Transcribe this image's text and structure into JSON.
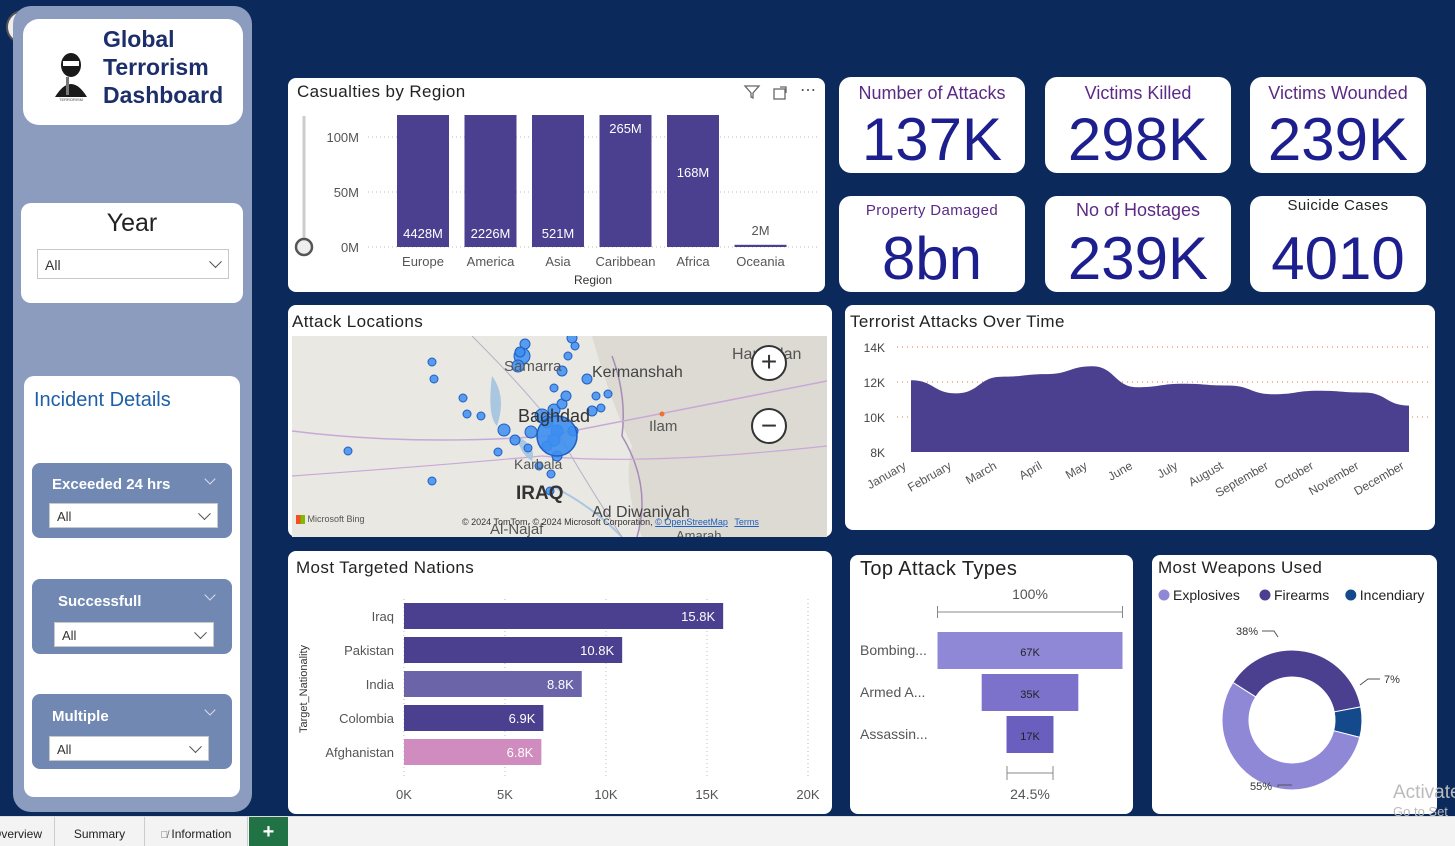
{
  "header": {
    "title_line1": "Global",
    "title_line2": "Terrorism",
    "title_line3": "Dashboard"
  },
  "slicers": {
    "year": {
      "label": "Year",
      "value": "All"
    },
    "incident_title": "Incident Details",
    "exceeded": {
      "label": "Exceeded 24 hrs",
      "value": "All"
    },
    "successful": {
      "label": "Successfull",
      "value": "All"
    },
    "multiple": {
      "label": "Multiple",
      "value": "All"
    }
  },
  "kpis": {
    "attacks": {
      "label": "Number of Attacks",
      "value": "137K"
    },
    "killed": {
      "label": "Victims Killed",
      "value": "298K"
    },
    "wounded": {
      "label": "Victims Wounded",
      "value": "239K"
    },
    "property": {
      "label": "Property Damaged",
      "value": "8bn"
    },
    "hostages": {
      "label": "No of Hostages",
      "value": "239K"
    },
    "suicide": {
      "label": "Suicide Cases",
      "value": "4010"
    }
  },
  "casualties": {
    "title": "Casualties by Region",
    "xlabel": "Region",
    "yticks": [
      "100M",
      "50M",
      "0M"
    ]
  },
  "map": {
    "title": "Attack Locations",
    "labels": {
      "samarra": "Samarra",
      "kermanshah": "Kermanshah",
      "baghdad": "Baghdad",
      "ilam": "Ilam",
      "karbala": "Karbala",
      "iraq": "IRAQ",
      "diwaniyah": "Ad Diwaniyah",
      "najaf": "Al-Najaf",
      "hamadan": "Hamadan",
      "amarah": "Amarah"
    },
    "brand": "Microsoft Bing",
    "attribution": "© 2024 TomTom, © 2024 Microsoft Corporation,",
    "osm": "© OpenStreetMap",
    "terms": "Terms"
  },
  "over_time": {
    "title": "Terrorist Attacks Over Time"
  },
  "nations": {
    "title": "Most Targeted Nations",
    "ylabel": "Target_Nationality"
  },
  "attack_types": {
    "title": "Top Attack Types",
    "top_pct": "100%",
    "bottom_pct": "24.5%"
  },
  "weapons": {
    "title": "Most Weapons Used"
  },
  "tabs": {
    "overview": "Overview",
    "summary": "Summary",
    "information": "Information",
    "add": "+"
  },
  "watermark": {
    "line1": "Activate",
    "line2": "Go to Set"
  },
  "colors": {
    "navy": "#0b2a5b",
    "bar": "#4b3f8f",
    "kpi_value": "#1e1f8f",
    "kpi_label": "#5b2a86",
    "area": "#4b3f8f"
  },
  "chart_data": [
    {
      "type": "bar",
      "title": "Casualties by Region",
      "xlabel": "Region",
      "categories": [
        "Europe",
        "America",
        "Asia",
        "Caribbean",
        "Africa",
        "Oceania"
      ],
      "values": [
        4428,
        2226,
        521,
        265,
        168,
        2
      ],
      "labels": [
        "4428M",
        "2226M",
        "521M",
        "265M",
        "168M",
        "2M"
      ],
      "ylim": [
        0,
        120
      ]
    },
    {
      "type": "area",
      "title": "Terrorist Attacks Over Time",
      "categories": [
        "January",
        "February",
        "March",
        "April",
        "May",
        "June",
        "July",
        "August",
        "September",
        "October",
        "November",
        "December"
      ],
      "values": [
        12100,
        11350,
        12300,
        12450,
        12900,
        11700,
        11900,
        11800,
        11300,
        11500,
        11400,
        10650
      ],
      "yticks": [
        "14K",
        "12K",
        "10K",
        "8K"
      ],
      "ylim": [
        8000,
        14000
      ]
    },
    {
      "type": "bar",
      "title": "Most Targeted Nations",
      "ylabel": "Target_Nationality",
      "categories": [
        "Iraq",
        "Pakistan",
        "India",
        "Colombia",
        "Afghanistan"
      ],
      "values": [
        15800,
        10800,
        8800,
        6900,
        6800
      ],
      "labels": [
        "15.8K",
        "10.8K",
        "8.8K",
        "6.9K",
        "6.8K"
      ],
      "colors": [
        "#4b3f8f",
        "#4b3f8f",
        "#6b64a8",
        "#4b3f8f",
        "#d08cbf"
      ],
      "xticks": [
        "0K",
        "5K",
        "10K",
        "15K",
        "20K"
      ],
      "xlim": [
        0,
        20000
      ]
    },
    {
      "type": "bar",
      "title": "Top Attack Types",
      "categories": [
        "Bombing...",
        "Armed A...",
        "Assassin..."
      ],
      "values": [
        67000,
        35000,
        17000
      ],
      "labels": [
        "67K",
        "35K",
        "17K"
      ]
    },
    {
      "type": "pie",
      "title": "Most Weapons Used",
      "categories": [
        "Explosives",
        "Firearms",
        "Incendiary"
      ],
      "values": [
        55,
        38,
        7
      ],
      "labels": [
        "55%",
        "38%",
        "7%"
      ],
      "colors": [
        "#8f88d6",
        "#4b3f8f",
        "#144a8c"
      ]
    }
  ]
}
